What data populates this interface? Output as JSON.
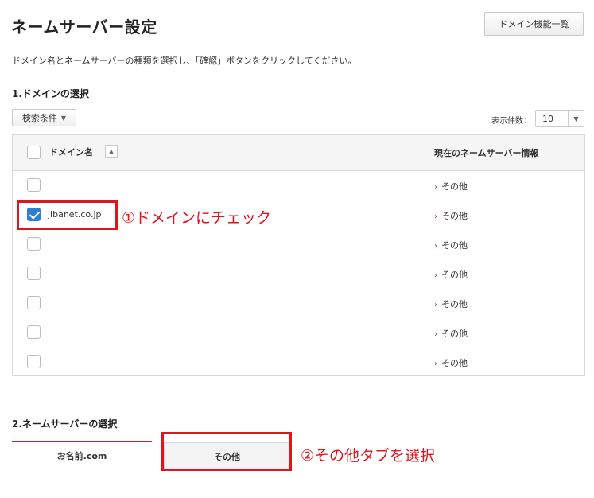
{
  "page": {
    "title": "ネームサーバー設定",
    "domain_list_button": "ドメイン機能一覧",
    "instruction": "ドメイン名とネームサーバーの種類を選択し、「確認」ボタンをクリックしてください。"
  },
  "section1": {
    "title": "1.ドメインの選択",
    "filter_button": "検索条件",
    "count_label": "表示件数：",
    "count_value": "10"
  },
  "table": {
    "header_domain": "ドメイン名",
    "header_ns": "現在のネームサーバー情報",
    "rows": [
      {
        "domain": "",
        "ns": "その他",
        "checked": false
      },
      {
        "domain": "jibanet.co.jp",
        "ns": "その他",
        "checked": true
      },
      {
        "domain": "",
        "ns": "その他",
        "checked": false
      },
      {
        "domain": "",
        "ns": "その他",
        "checked": false
      },
      {
        "domain": "",
        "ns": "その他",
        "checked": false
      },
      {
        "domain": "",
        "ns": "その他",
        "checked": false
      },
      {
        "domain": "",
        "ns": "その他",
        "checked": false
      }
    ]
  },
  "annotations": {
    "step1": "①ドメインにチェック",
    "step2": "②その他タブを選択"
  },
  "section2": {
    "title": "2.ネームサーバーの選択",
    "tabs": [
      {
        "label": "お名前.com"
      },
      {
        "label": "その他"
      }
    ]
  },
  "colors": {
    "accent_red": "#c0282d",
    "highlight_red": "#e0141e",
    "checkbox_blue": "#2f7fd1"
  }
}
